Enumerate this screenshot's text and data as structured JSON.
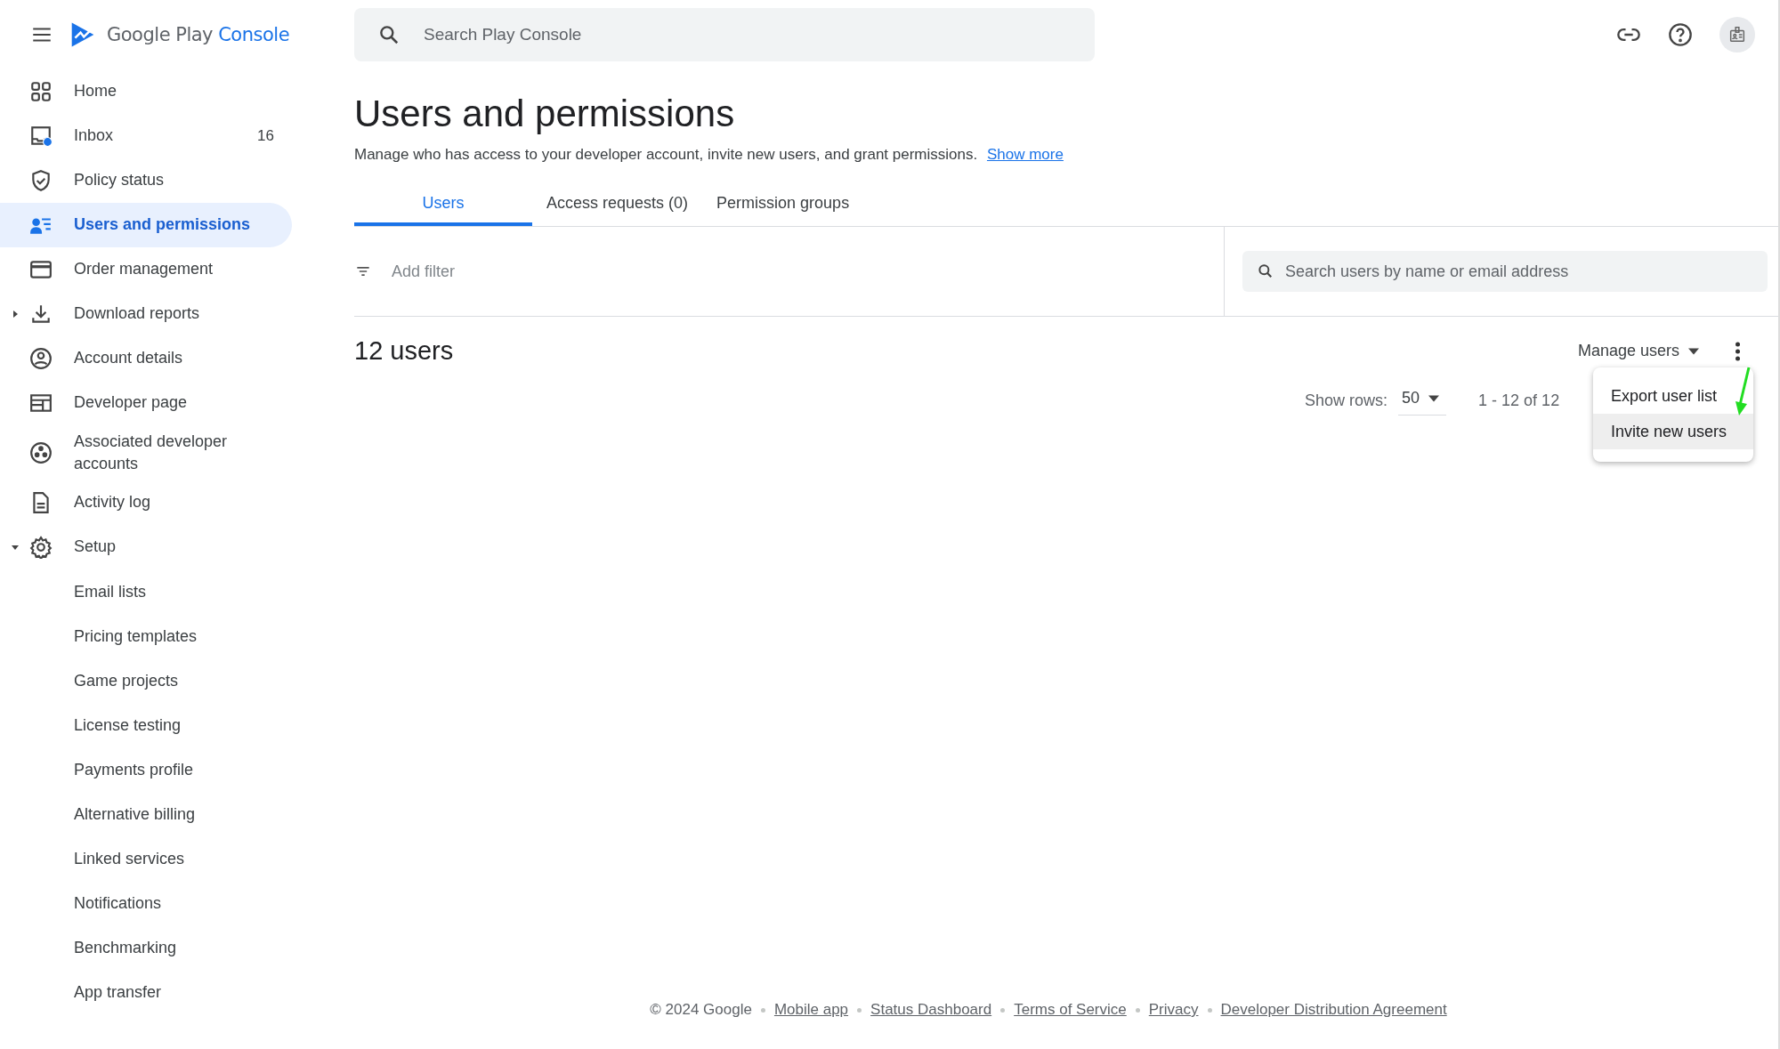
{
  "app": {
    "logo_text": "Google Play",
    "logo_accent": "Console"
  },
  "search": {
    "placeholder": "Search Play Console"
  },
  "sidebar": {
    "items": [
      {
        "label": "Home",
        "selected": false
      },
      {
        "label": "Inbox",
        "selected": false,
        "count": "16",
        "unread": true
      },
      {
        "label": "Policy status",
        "selected": false
      },
      {
        "label": "Users and permissions",
        "selected": true
      },
      {
        "label": "Order management",
        "selected": false
      },
      {
        "label": "Download reports",
        "selected": false,
        "expanded": false
      },
      {
        "label": "Account details",
        "selected": false
      },
      {
        "label": "Developer page",
        "selected": false
      },
      {
        "label": "Associated developer accounts",
        "selected": false
      },
      {
        "label": "Activity log",
        "selected": false
      },
      {
        "label": "Setup",
        "selected": false,
        "expanded": true,
        "children": [
          {
            "label": "Email lists",
            "selected": false
          },
          {
            "label": "Pricing templates",
            "selected": false
          },
          {
            "label": "Game projects",
            "selected": false
          },
          {
            "label": "License testing",
            "selected": false
          },
          {
            "label": "Payments profile",
            "selected": false
          },
          {
            "label": "Alternative billing",
            "selected": false
          },
          {
            "label": "Linked services",
            "selected": false
          },
          {
            "label": "Notifications",
            "selected": false
          },
          {
            "label": "Benchmarking",
            "selected": false
          },
          {
            "label": "App transfer",
            "selected": false
          }
        ]
      }
    ]
  },
  "page": {
    "title": "Users and permissions",
    "description": "Manage who has access to your developer account, invite new users, and grant permissions.",
    "more_link": "Show more"
  },
  "tabs": [
    {
      "label": "Users",
      "selected": true
    },
    {
      "label": "Access requests (0)",
      "selected": false
    },
    {
      "label": "Permission groups",
      "selected": false
    }
  ],
  "filter": {
    "placeholder": "Add filter"
  },
  "user_search": {
    "placeholder": "Search users by name or email address"
  },
  "users": {
    "count": "12 users",
    "manage_button": "Manage users",
    "show_rows_label": "Show rows:",
    "rows_value": "50",
    "range": "1 - 12 of 12"
  },
  "menu": {
    "items": [
      {
        "label": "Export user list",
        "selected": false
      },
      {
        "label": "Invite new users",
        "selected": true
      }
    ]
  },
  "footer": {
    "copyright": "© 2024 Google",
    "links": [
      "Mobile app",
      "Status Dashboard",
      "Terms of Service",
      "Privacy",
      "Developer Distribution Agreement"
    ]
  }
}
